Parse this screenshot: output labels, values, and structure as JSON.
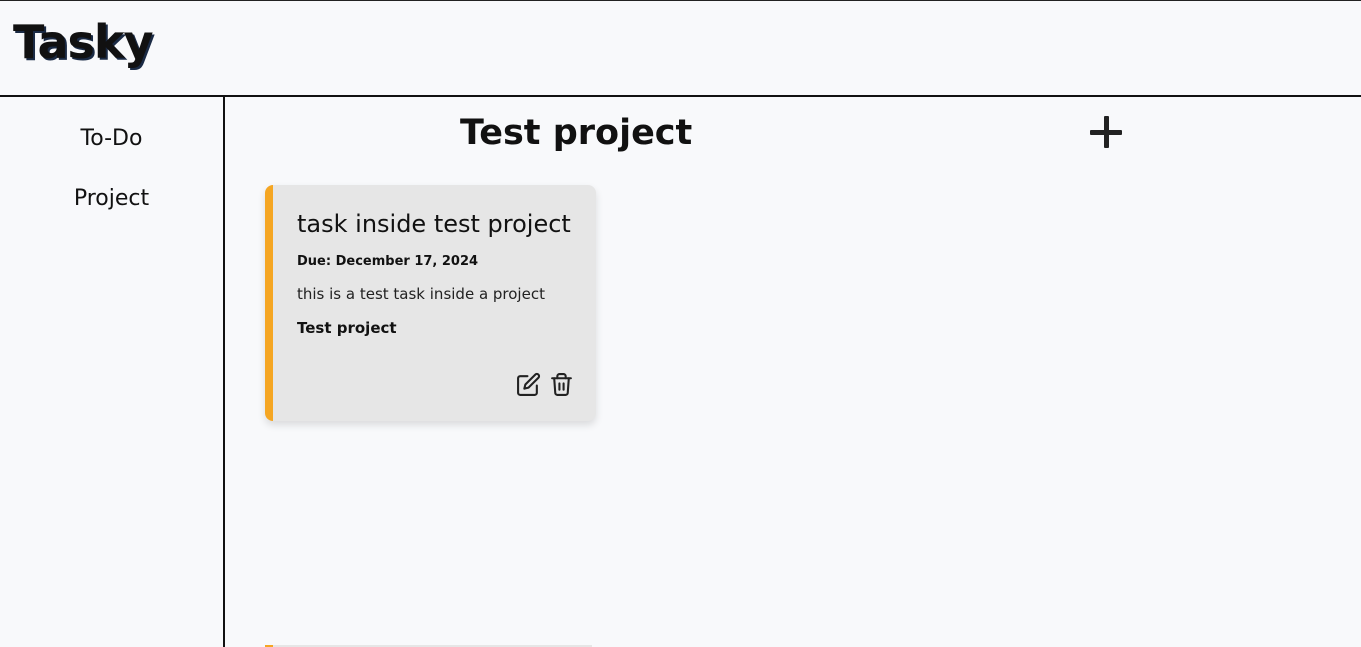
{
  "app": {
    "logo": "Tasky"
  },
  "sidebar": {
    "items": [
      {
        "label": "To-Do"
      },
      {
        "label": "Project"
      }
    ]
  },
  "main": {
    "title": "Test project",
    "add_icon": "plus-icon",
    "tasks": [
      {
        "title": "task inside test project",
        "due": "Due: December 17, 2024",
        "description": "this is a test task inside a project",
        "project": "Test project",
        "priority_color": "#f5a623",
        "edit_icon": "edit-icon",
        "delete_icon": "trash-icon"
      }
    ]
  },
  "colors": {
    "background": "#f8f9fb",
    "card_background": "#e6e6e6",
    "accent": "#f5a623"
  }
}
